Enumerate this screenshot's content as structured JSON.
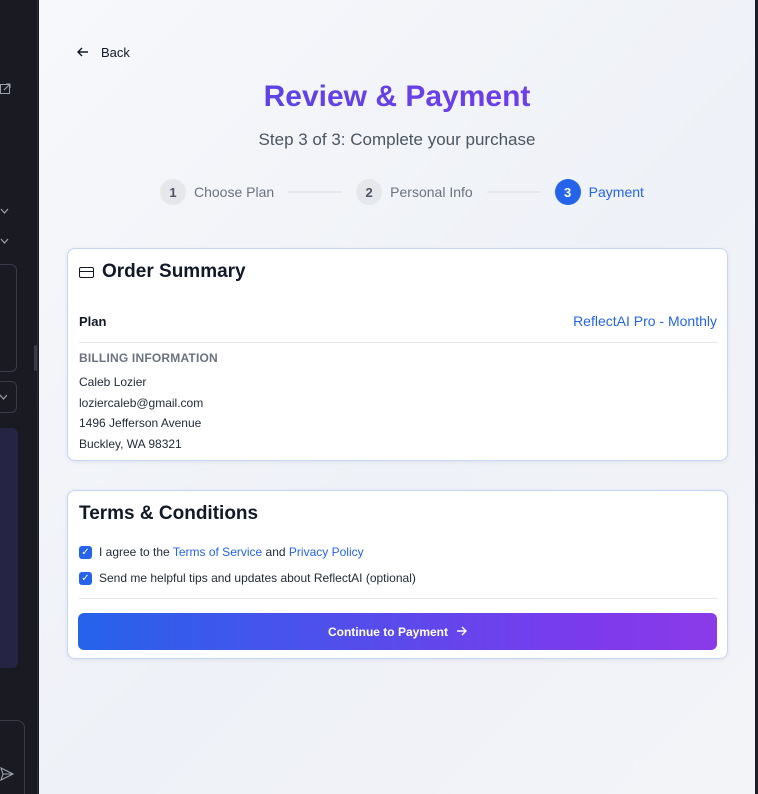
{
  "nav": {
    "back_label": "Back"
  },
  "header": {
    "title": "Review & Payment",
    "subtitle": "Step 3 of 3: Complete your purchase"
  },
  "steps": [
    {
      "number": "1",
      "label": "Choose Plan",
      "active": false
    },
    {
      "number": "2",
      "label": "Personal Info",
      "active": false
    },
    {
      "number": "3",
      "label": "Payment",
      "active": true
    }
  ],
  "order_summary": {
    "title": "Order Summary",
    "plan_label": "Plan",
    "plan_value": "ReflectAI Pro - Monthly",
    "billing_heading": "BILLING INFORMATION",
    "billing_lines": [
      "Caleb Lozier",
      "loziercaleb@gmail.com",
      "1496 Jefferson Avenue",
      "Buckley, WA 98321"
    ]
  },
  "terms": {
    "title": "Terms & Conditions",
    "agree_prefix": "I agree to the",
    "terms_link": "Terms of Service",
    "and_text": "and",
    "privacy_link": "Privacy Policy",
    "tips_label": "Send me helpful tips and updates about ReflectAI (optional)",
    "agree_checked": true,
    "tips_checked": true
  },
  "cta": {
    "label": "Continue to Payment"
  },
  "colors": {
    "accent": "#2563eb",
    "title_gradient_start": "#4f46e5",
    "title_gradient_end": "#7c3aed",
    "button_gradient_end": "#8b3be8"
  }
}
